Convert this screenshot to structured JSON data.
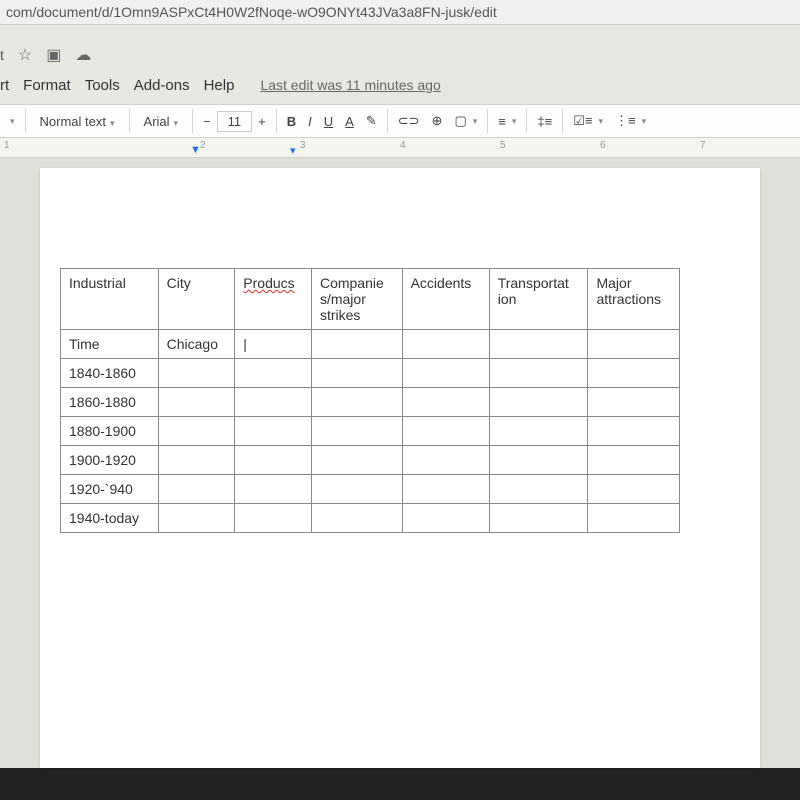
{
  "url": "com/document/d/1Omn9ASPxCt4H0W2fNoqe-wO9ONYt43JVa3a8FN-jusk/edit",
  "menu": {
    "items": [
      "rt",
      "Format",
      "Tools",
      "Add-ons",
      "Help"
    ],
    "edit_status": "Last edit was 11 minutes ago"
  },
  "toolbar": {
    "style_name": "Normal text",
    "font_name": "Arial",
    "font_size": "11"
  },
  "ruler": {
    "marks": [
      "1",
      "2",
      "3",
      "4",
      "5",
      "6",
      "7"
    ]
  },
  "table": {
    "headers": [
      "Industrial",
      "City",
      "Producs",
      "Companies/major strikes",
      "Accidents",
      "Transportation",
      "Major attractions"
    ],
    "row1": {
      "col0": "Time",
      "col1": "Chicago"
    },
    "periods": [
      "1840-1860",
      "1860-1880",
      "1880-1900",
      "1900-1920",
      "1920-`940",
      "1940-today"
    ]
  }
}
